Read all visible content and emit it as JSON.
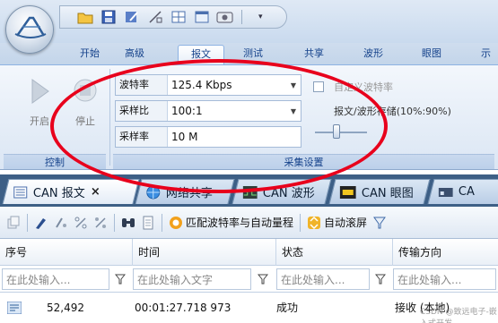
{
  "ribbon_tabs": [
    "开始",
    "高级",
    "报文",
    "测试",
    "共享",
    "波形",
    "眼图",
    "示"
  ],
  "active_tab_index": 2,
  "control_group": {
    "start_label": "开启",
    "stop_label": "停止",
    "group_label": "控制"
  },
  "collect_group": {
    "baud_label": "波特率",
    "baud_value": "125.4 Kbps",
    "ratio_label": "采样比",
    "ratio_value": "100:1",
    "rate_label": "采样率",
    "rate_value": "10 M",
    "custom_baud_label": "自定义波特率",
    "storage_label": "报文/波形存储(10%:90%)",
    "group_label": "采集设置",
    "storage_ratio_percent": 10
  },
  "doc_tabs": [
    {
      "label": "CAN 报文",
      "closable": true
    },
    {
      "label": "网络共享"
    },
    {
      "label": "CAN 波形"
    },
    {
      "label": "CAN 眼图"
    },
    {
      "label": "CA"
    }
  ],
  "toolbar": {
    "match_label": "匹配波特率与自动量程",
    "autoscroll_label": "自动滚屏"
  },
  "table": {
    "columns": [
      "序号",
      "时间",
      "状态",
      "传输方向"
    ],
    "filter_placeholders": [
      "在此处输入...",
      "在此处输入文字",
      "在此处输入...",
      "在此处输入..."
    ],
    "rows": [
      {
        "index": "52,492",
        "time": "00:01:27.718 973",
        "status": "成功",
        "direction": "接收 (本地)"
      }
    ]
  },
  "watermark": "CSDN @致远电子-嵌入式开发",
  "colors": {
    "annotation": "#e8001c",
    "link_blue": "#15428b"
  }
}
